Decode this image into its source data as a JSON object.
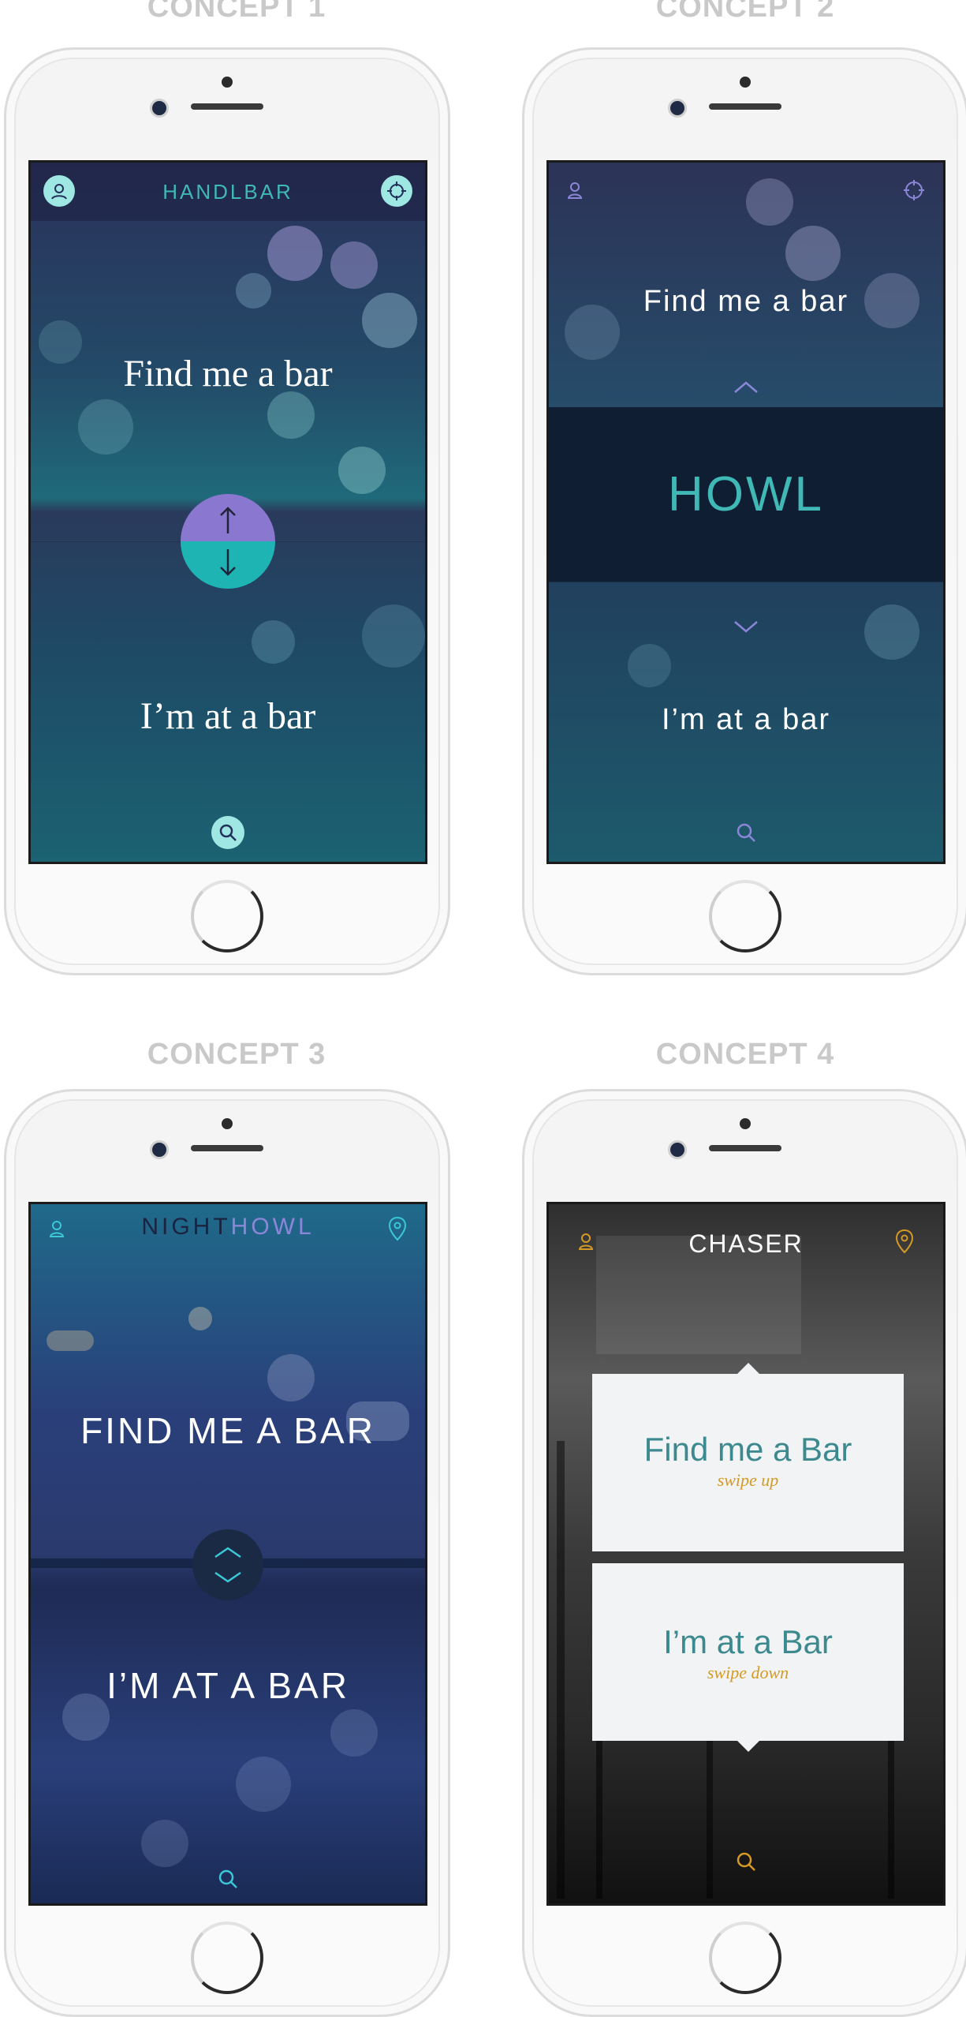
{
  "concepts": [
    {
      "title": "CONCEPT 1",
      "app_title": "HANDLBAR",
      "top_action": "Find me a bar",
      "bottom_action": "I’m at a bar"
    },
    {
      "title": "CONCEPT 2",
      "center_title": "HOWL",
      "top_action": "Find me a bar",
      "bottom_action": "I’m at a bar"
    },
    {
      "title": "CONCEPT 3",
      "app_title_part1": "NIGHT",
      "app_title_part2": "HOWL",
      "top_action": "FIND ME A BAR",
      "bottom_action": "I’M AT A BAR"
    },
    {
      "title": "CONCEPT 4",
      "app_title": "CHASER",
      "top_card_title": "Find me a Bar",
      "top_card_hint": "swipe up",
      "bottom_card_title": "I’m at a Bar",
      "bottom_card_hint": "swipe down"
    }
  ],
  "colors": {
    "c1_accent": "#9fe7e2",
    "c1_purple": "#8a77cf",
    "c1_teal": "#1fb4b4",
    "c2_purple": "#8c86d8",
    "c2_teal": "#3fb8b6",
    "c3_teal": "#3bc7d6",
    "c3_purple": "#8c86d8",
    "c4_orange": "#d59a22",
    "c4_card_text": "#3c8a90"
  },
  "icons": {
    "profile": "profile-icon",
    "target": "target-icon",
    "search": "search-icon",
    "location": "location-pin-icon",
    "up": "chevron-up-icon",
    "down": "chevron-down-icon",
    "arrow_up": "arrow-up-icon",
    "arrow_down": "arrow-down-icon"
  }
}
